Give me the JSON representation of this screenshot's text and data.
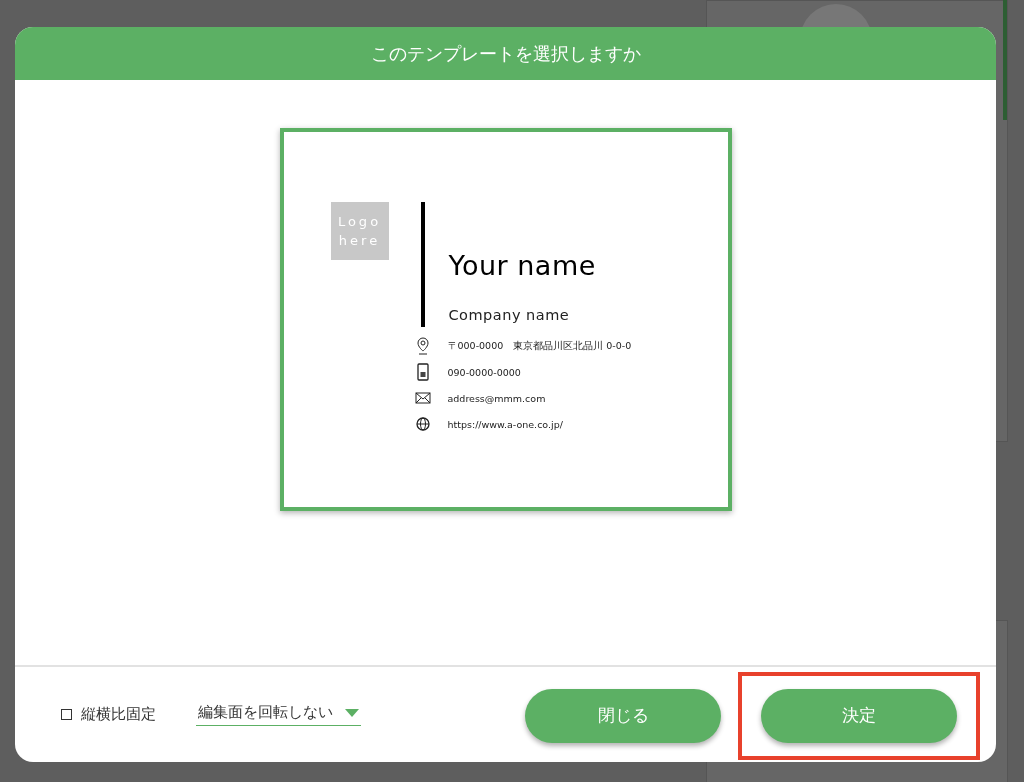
{
  "dialog": {
    "title": "このテンプレートを選択しますか"
  },
  "template_preview": {
    "logo_placeholder": "Logo\nhere",
    "name": "Your name",
    "company": "Company name",
    "contacts": [
      {
        "kind": "address",
        "text": "〒000-0000　東京都品川区北品川 0-0-0"
      },
      {
        "kind": "phone",
        "text": "090-0000-0000"
      },
      {
        "kind": "mail",
        "text": "address@mmm.com"
      },
      {
        "kind": "web",
        "text": "https://www.a-one.co.jp/"
      }
    ]
  },
  "footer": {
    "aspect_lock": {
      "label": "縦横比固定",
      "checked": false
    },
    "rotation_select": {
      "value": "編集面を回転しない"
    },
    "buttons": [
      {
        "label": "閉じる",
        "highlighted": false
      },
      {
        "label": "決定",
        "highlighted": true
      }
    ]
  }
}
